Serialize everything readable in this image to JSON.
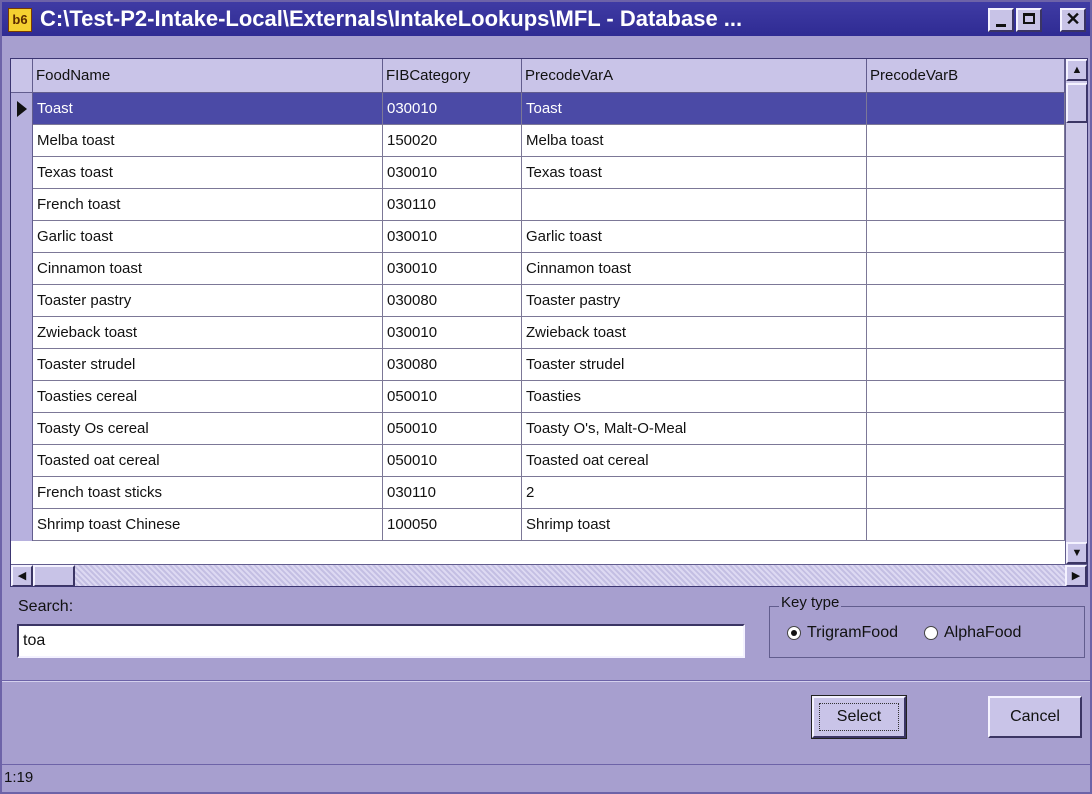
{
  "window": {
    "title": "C:\\Test-P2-Intake-Local\\Externals\\IntakeLookups\\MFL - Database ...",
    "icon_text": "b6",
    "buttons": {
      "minimize": "minimize",
      "maximize": "maximize",
      "close": "✕"
    }
  },
  "grid": {
    "columns": [
      "FoodName",
      "FIBCategory",
      "PrecodeVarA",
      "PrecodeVarB"
    ],
    "selected_row": 0,
    "rows": [
      [
        "Toast",
        "030010",
        "Toast",
        ""
      ],
      [
        "Melba toast",
        "150020",
        "Melba toast",
        ""
      ],
      [
        "Texas toast",
        "030010",
        "Texas toast",
        ""
      ],
      [
        "French toast",
        "030110",
        "",
        ""
      ],
      [
        "Garlic toast",
        "030010",
        "Garlic toast",
        ""
      ],
      [
        "Cinnamon toast",
        "030010",
        "Cinnamon toast",
        ""
      ],
      [
        "Toaster pastry",
        "030080",
        "Toaster pastry",
        ""
      ],
      [
        "Zwieback toast",
        "030010",
        "Zwieback toast",
        ""
      ],
      [
        "Toaster strudel",
        "030080",
        "Toaster strudel",
        ""
      ],
      [
        "Toasties cereal",
        "050010",
        "Toasties",
        ""
      ],
      [
        "Toasty Os cereal",
        "050010",
        "Toasty O's, Malt-O-Meal",
        ""
      ],
      [
        "Toasted oat cereal",
        "050010",
        "Toasted oat cereal",
        ""
      ],
      [
        "French toast sticks",
        "030110",
        "2",
        ""
      ],
      [
        "Shrimp toast Chinese",
        "100050",
        "Shrimp toast",
        ""
      ]
    ]
  },
  "search": {
    "label": "Search:",
    "value": "toa"
  },
  "key_type": {
    "legend": "Key type",
    "options": [
      {
        "label": "TrigramFood",
        "selected": true
      },
      {
        "label": "AlphaFood",
        "selected": false
      }
    ]
  },
  "buttons": {
    "select": "Select",
    "cancel": "Cancel"
  },
  "status": {
    "text": "1:19"
  },
  "colors": {
    "selection": "#4b4aa6",
    "background": "#a79fcf",
    "title_bar": "#2f2b93"
  }
}
